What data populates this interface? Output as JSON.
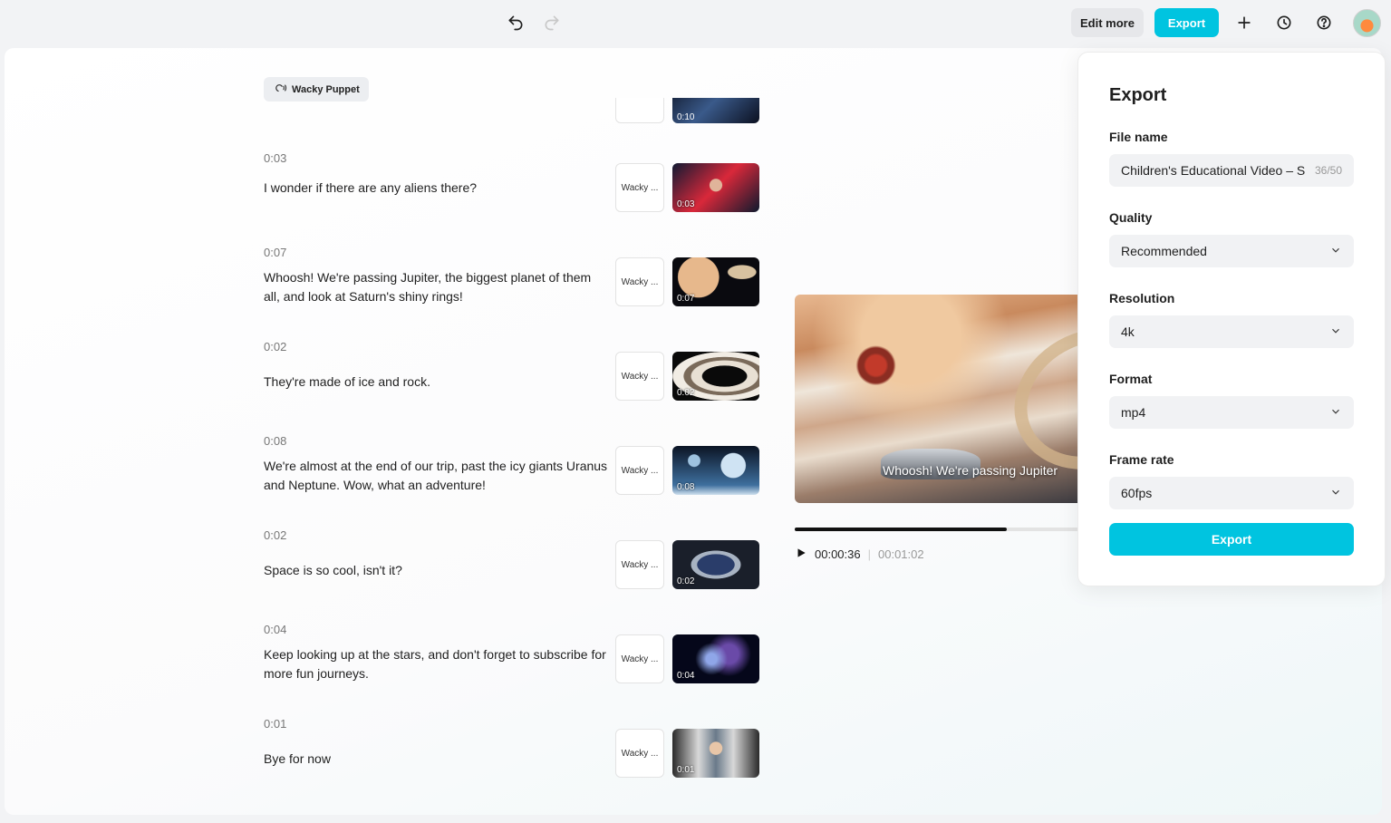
{
  "toolbar": {
    "undo_icon": "undo-icon",
    "redo_icon": "redo-icon",
    "edit_more_label": "Edit more",
    "export_label": "Export",
    "add_icon": "plus-icon",
    "history_icon": "history-icon",
    "help_icon": "help-icon",
    "accent_color": "#00c4e0"
  },
  "voice_chip": {
    "label": "Wacky Puppet",
    "icon": "voice-icon"
  },
  "scenes": [
    {
      "time": "0:03",
      "text": "I wonder if there are any aliens there?",
      "voice": "Wacky ...",
      "thumb_time": "0:03"
    },
    {
      "time": "0:07",
      "text": "Whoosh! We're passing Jupiter, the biggest planet of them all, and look at Saturn's shiny rings!",
      "voice": "Wacky ...",
      "thumb_time": "0:07"
    },
    {
      "time": "0:02",
      "text": "They're made of ice and rock.",
      "voice": "Wacky ...",
      "thumb_time": "0:02"
    },
    {
      "time": "0:08",
      "text": "We're almost at the end of our trip, past the icy giants Uranus and Neptune. Wow, what an adventure!",
      "voice": "Wacky ...",
      "thumb_time": "0:08"
    },
    {
      "time": "0:02",
      "text": "Space is so cool, isn't it?",
      "voice": "Wacky ...",
      "thumb_time": "0:02"
    },
    {
      "time": "0:04",
      "text": "Keep looking up at the stars, and don't forget to subscribe for more fun journeys.",
      "voice": "Wacky ...",
      "thumb_time": "0:04"
    },
    {
      "time": "0:01",
      "text": "Bye for now",
      "voice": "Wacky ...",
      "thumb_time": "0:01"
    }
  ],
  "partial_scene": {
    "thumb_time": "0:10"
  },
  "preview": {
    "caption": "Whoosh! We're passing Jupiter",
    "current_time": "00:00:36",
    "duration": "00:01:02",
    "progress_fraction": 0.73
  },
  "export_panel": {
    "title": "Export",
    "file_name_label": "File name",
    "file_name_value": "Children's Educational Video – S",
    "file_name_count": "36/50",
    "quality_label": "Quality",
    "quality_value": "Recommended",
    "resolution_label": "Resolution",
    "resolution_value": "4k",
    "format_label": "Format",
    "format_value": "mp4",
    "frame_rate_label": "Frame rate",
    "frame_rate_value": "60fps",
    "export_button": "Export"
  }
}
